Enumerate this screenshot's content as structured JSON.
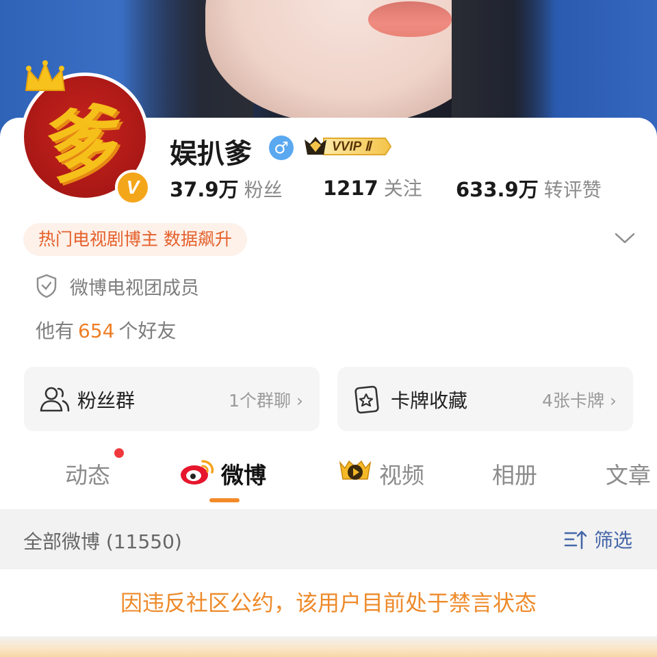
{
  "profile": {
    "name": "娱扒爹",
    "gender_symbol": "♂",
    "vip_label": "VVIP Ⅱ",
    "avatar_glyph": "爹",
    "verified_badge": "V"
  },
  "stats": [
    {
      "value": "37.9万",
      "label": "粉丝"
    },
    {
      "value": "1217",
      "label": "关注"
    },
    {
      "value": "633.9万",
      "label": "转评赞"
    }
  ],
  "hot_tag": "热门电视剧博主 数据飙升",
  "membership": "微博电视团成员",
  "friends": {
    "prefix": "他有",
    "count": "654",
    "suffix": "个好友"
  },
  "tiles": [
    {
      "title": "粉丝群",
      "meta": "1个群聊"
    },
    {
      "title": "卡牌收藏",
      "meta": "4张卡牌"
    }
  ],
  "tabs": [
    {
      "label": "动态"
    },
    {
      "label": "微博"
    },
    {
      "label": "视频"
    },
    {
      "label": "相册"
    },
    {
      "label": "文章"
    }
  ],
  "feed": {
    "title": "全部微博 (11550)",
    "filter_label": "筛选",
    "notice": "因违反社区公约，该用户目前处于禁言状态"
  },
  "colors": {
    "accent_orange": "#ef7d25",
    "tag_text": "#e5602a",
    "filter_blue": "#4466a8",
    "notice": "#ee8a2a"
  }
}
